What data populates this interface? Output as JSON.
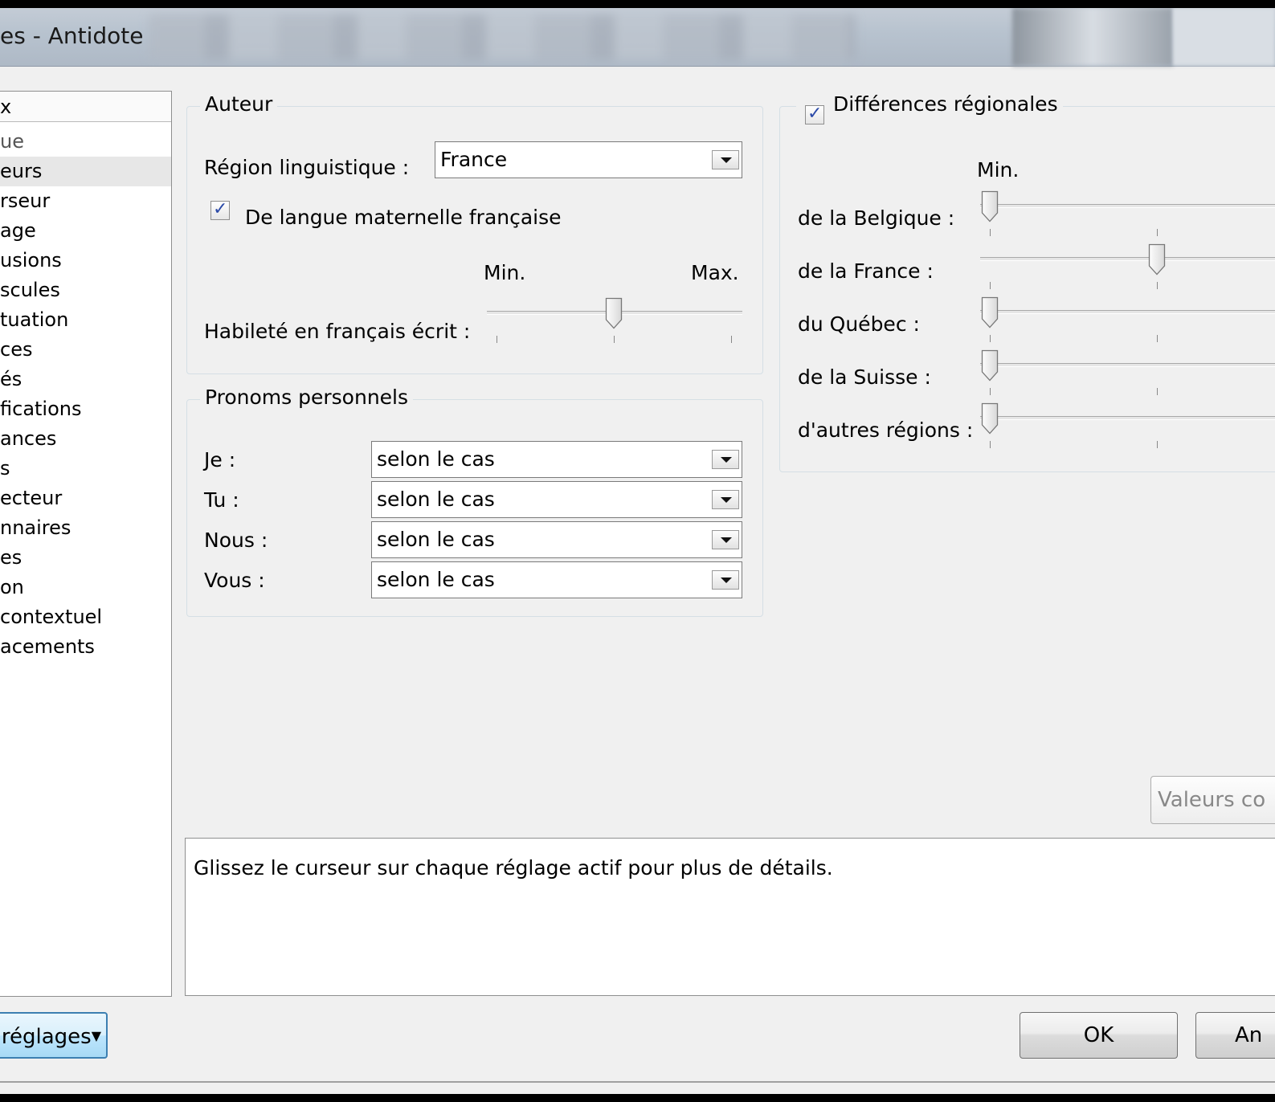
{
  "window": {
    "title": "es - Antidote"
  },
  "nav": {
    "header": "x",
    "items": [
      {
        "label": "ue",
        "selected": false
      },
      {
        "label": "eurs",
        "selected": true
      },
      {
        "label": "rseur",
        "selected": false
      },
      {
        "label": "age",
        "selected": false
      },
      {
        "label": "usions",
        "selected": false
      },
      {
        "label": "scules",
        "selected": false
      },
      {
        "label": "tuation",
        "selected": false
      },
      {
        "label": "ces",
        "selected": false
      },
      {
        "label": "és",
        "selected": false
      },
      {
        "label": "fications",
        "selected": false
      },
      {
        "label": "ances",
        "selected": false
      },
      {
        "label": "s",
        "selected": false
      },
      {
        "label": "ecteur",
        "selected": false
      },
      {
        "label": "nnaires",
        "selected": false
      },
      {
        "label": "es",
        "selected": false
      },
      {
        "label": "on",
        "selected": false
      },
      {
        "label": " contextuel",
        "selected": false
      },
      {
        "label": "acements",
        "selected": false
      }
    ]
  },
  "auteur": {
    "group_title": "Auteur",
    "region_label": "Région linguistique :",
    "region_value": "France",
    "maternelle_label": "De langue maternelle française",
    "maternelle_checked": true,
    "min_label": "Min.",
    "max_label": "Max.",
    "habilete_label": "Habileté en français écrit :",
    "habilete_level": 0.5
  },
  "pronoms": {
    "group_title": "Pronoms personnels",
    "rows": [
      {
        "label": "Je :",
        "value": "selon le cas"
      },
      {
        "label": "Tu :",
        "value": "selon le cas"
      },
      {
        "label": "Nous :",
        "value": "selon le cas"
      },
      {
        "label": "Vous :",
        "value": "selon le cas"
      }
    ]
  },
  "regions": {
    "group_title": "Différences régionales",
    "checked": true,
    "min_label": "Min.",
    "rows": [
      {
        "label": "de la Belgique :",
        "level": 0.0
      },
      {
        "label": "de la France :",
        "level": 0.5
      },
      {
        "label": "du Québec :",
        "level": 0.0
      },
      {
        "label": "de la Suisse :",
        "level": 0.0
      },
      {
        "label": "d'autres régions :",
        "level": 0.0
      }
    ]
  },
  "buttons": {
    "valeurs": "Valeurs co",
    "reglages": "réglages",
    "ok": "OK",
    "annuler": "An"
  },
  "description": "Glissez le curseur sur chaque réglage actif pour plus de détails."
}
